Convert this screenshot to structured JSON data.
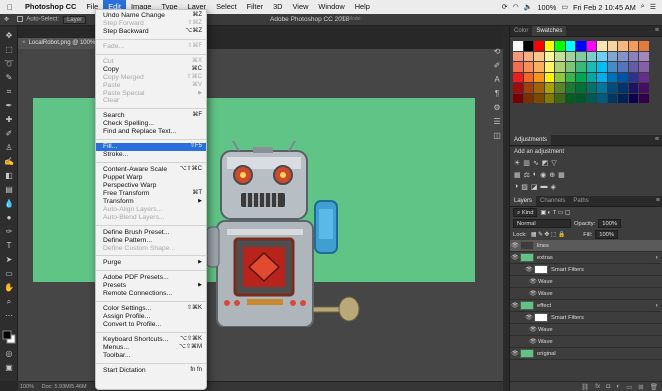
{
  "menubar": {
    "app_name": "Photoshop CC",
    "items": [
      "File",
      "Edit",
      "Image",
      "Type",
      "Layer",
      "Select",
      "Filter",
      "3D",
      "View",
      "Window",
      "Help"
    ],
    "battery": "100%",
    "clock": "Fri Feb 2  10:45 AM"
  },
  "options_bar": {
    "auto_select_label": "Auto-Select:",
    "auto_select_value": "Layer",
    "window_title": "Adobe Photoshop CC 2018",
    "mode_label": "3D Mode:"
  },
  "document": {
    "tab_label": "LocalRobot.png @ 100%",
    "status_zoom": "100%",
    "status_doc": "Doc: 5.93M/5.46M",
    "canvas_color": "#5fc485"
  },
  "edit_menu": {
    "rows": [
      {
        "label": "Undo Name Change",
        "shortcut": "⌘Z",
        "state": "normal"
      },
      {
        "label": "Step Forward",
        "shortcut": "⇧⌘Z",
        "state": "disabled"
      },
      {
        "label": "Step Backward",
        "shortcut": "⌥⌘Z",
        "state": "normal"
      },
      {
        "sep": true
      },
      {
        "label": "Fade...",
        "shortcut": "⇧⌘F",
        "state": "disabled"
      },
      {
        "sep": true
      },
      {
        "label": "Cut",
        "shortcut": "⌘X",
        "state": "disabled"
      },
      {
        "label": "Copy",
        "shortcut": "⌘C",
        "state": "normal"
      },
      {
        "label": "Copy Merged",
        "shortcut": "⇧⌘C",
        "state": "disabled"
      },
      {
        "label": "Paste",
        "shortcut": "⌘V",
        "state": "disabled"
      },
      {
        "label": "Paste Special",
        "shortcut": "",
        "state": "disabled",
        "submenu": true
      },
      {
        "label": "Clear",
        "shortcut": "",
        "state": "disabled"
      },
      {
        "sep": true
      },
      {
        "label": "Search",
        "shortcut": "⌘F",
        "state": "normal"
      },
      {
        "label": "Check Spelling...",
        "shortcut": "",
        "state": "normal"
      },
      {
        "label": "Find and Replace Text...",
        "shortcut": "",
        "state": "normal"
      },
      {
        "sep": true
      },
      {
        "label": "Fill...",
        "shortcut": "⇧F5",
        "state": "highlight"
      },
      {
        "label": "Stroke...",
        "shortcut": "",
        "state": "normal"
      },
      {
        "sep": true
      },
      {
        "label": "Content-Aware Scale",
        "shortcut": "⌥⇧⌘C",
        "state": "normal"
      },
      {
        "label": "Puppet Warp",
        "shortcut": "",
        "state": "normal"
      },
      {
        "label": "Perspective Warp",
        "shortcut": "",
        "state": "normal"
      },
      {
        "label": "Free Transform",
        "shortcut": "⌘T",
        "state": "normal"
      },
      {
        "label": "Transform",
        "shortcut": "",
        "state": "normal",
        "submenu": true
      },
      {
        "label": "Auto-Align Layers...",
        "shortcut": "",
        "state": "disabled"
      },
      {
        "label": "Auto-Blend Layers...",
        "shortcut": "",
        "state": "disabled"
      },
      {
        "sep": true
      },
      {
        "label": "Define Brush Preset...",
        "shortcut": "",
        "state": "normal"
      },
      {
        "label": "Define Pattern...",
        "shortcut": "",
        "state": "normal"
      },
      {
        "label": "Define Custom Shape...",
        "shortcut": "",
        "state": "disabled"
      },
      {
        "sep": true
      },
      {
        "label": "Purge",
        "shortcut": "",
        "state": "normal",
        "submenu": true
      },
      {
        "sep": true
      },
      {
        "label": "Adobe PDF Presets...",
        "shortcut": "",
        "state": "normal"
      },
      {
        "label": "Presets",
        "shortcut": "",
        "state": "normal",
        "submenu": true
      },
      {
        "label": "Remote Connections...",
        "shortcut": "",
        "state": "normal"
      },
      {
        "sep": true
      },
      {
        "label": "Color Settings...",
        "shortcut": "⇧⌘K",
        "state": "normal"
      },
      {
        "label": "Assign Profile...",
        "shortcut": "",
        "state": "normal"
      },
      {
        "label": "Convert to Profile...",
        "shortcut": "",
        "state": "normal"
      },
      {
        "sep": true
      },
      {
        "label": "Keyboard Shortcuts...",
        "shortcut": "⌥⇧⌘K",
        "state": "normal"
      },
      {
        "label": "Menus...",
        "shortcut": "⌥⇧⌘M",
        "state": "normal"
      },
      {
        "label": "Toolbar...",
        "shortcut": "",
        "state": "normal"
      },
      {
        "sep": true
      },
      {
        "label": "Start Dictation",
        "shortcut": "fn fn",
        "state": "normal"
      }
    ]
  },
  "panels": {
    "color_tabs": [
      "Color",
      "Swatches"
    ],
    "swatch_colors": [
      "#ffffff",
      "#000000",
      "#ff0000",
      "#ffff00",
      "#00ff00",
      "#00ffff",
      "#0000ff",
      "#ff00ff",
      "#fce4b4",
      "#f9d49c",
      "#f6b87c",
      "#f29c5c",
      "#e37a3c",
      "#f7977a",
      "#f9ad81",
      "#fdc68a",
      "#fff79a",
      "#c4df9b",
      "#a2d39c",
      "#82ca9d",
      "#7bcdc8",
      "#6ecff6",
      "#7ea7d8",
      "#8493ca",
      "#8882be",
      "#a187be",
      "#f26c4f",
      "#f68e55",
      "#fbaf5c",
      "#fff467",
      "#acd372",
      "#7cc576",
      "#3bb878",
      "#1abbb4",
      "#00bff3",
      "#438cca",
      "#5574b9",
      "#605ca8",
      "#855fa8",
      "#ed1c24",
      "#f26522",
      "#f7941d",
      "#fff200",
      "#8dc73f",
      "#39b54a",
      "#00a651",
      "#00a99d",
      "#00aeef",
      "#0072bc",
      "#0054a6",
      "#2e3192",
      "#662d91",
      "#9e0b0f",
      "#a0410d",
      "#a36209",
      "#aba000",
      "#598527",
      "#1a7b30",
      "#007236",
      "#00746b",
      "#0076a3",
      "#004b80",
      "#003471",
      "#1b1464",
      "#440e62",
      "#790000",
      "#7b2e00",
      "#7d4900",
      "#827b00",
      "#406618",
      "#005e20",
      "#005826",
      "#005952",
      "#005b7f",
      "#003663",
      "#002157",
      "#0d004c",
      "#32004b"
    ],
    "adjustments_title": "Adjustments",
    "adjustments_label": "Add an adjustment",
    "layers_tabs": [
      "Layers",
      "Channels",
      "Paths"
    ],
    "kind_label": "Kind",
    "blend_mode": "Normal",
    "opacity_label": "Opacity:",
    "opacity_value": "100%",
    "lock_label": "Lock:",
    "fill_label": "Fill:",
    "fill_value": "100%",
    "layers": [
      {
        "name": "lines",
        "type": "layer",
        "selected": true
      },
      {
        "name": "extras",
        "type": "layer",
        "fx": true
      },
      {
        "name": "Smart Filters",
        "type": "sub"
      },
      {
        "name": "Wave",
        "type": "sub2"
      },
      {
        "name": "Wave",
        "type": "sub2"
      },
      {
        "name": "effect",
        "type": "layer",
        "fx": true
      },
      {
        "name": "Smart Filters",
        "type": "sub"
      },
      {
        "name": "Wave",
        "type": "sub2"
      },
      {
        "name": "Wave",
        "type": "sub2"
      },
      {
        "name": "original",
        "type": "layer"
      }
    ]
  }
}
